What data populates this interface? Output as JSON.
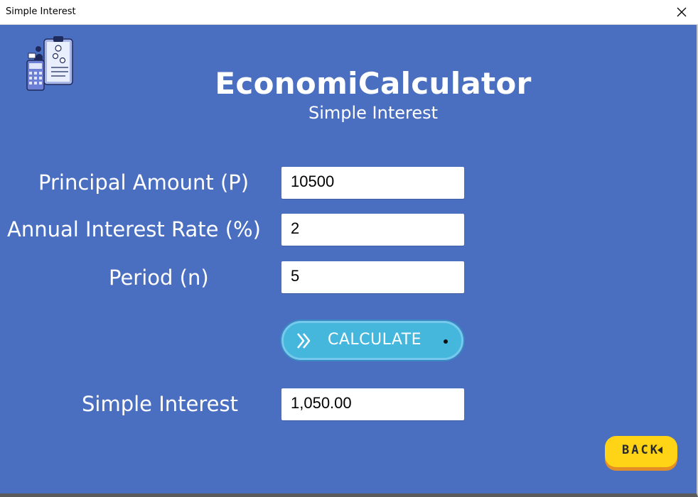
{
  "window": {
    "title": "Simple Interest"
  },
  "header": {
    "app_title": "EconomiCalculator",
    "subtitle": "Simple Interest"
  },
  "form": {
    "principal_label": "Principal Amount (P)",
    "principal_value": "10500",
    "rate_label": "Annual Interest Rate (%)",
    "rate_value": "2",
    "period_label": "Period (n)",
    "period_value": "5"
  },
  "calculate_button": {
    "label": "CALCULATE"
  },
  "result": {
    "label": "Simple Interest",
    "value": "1,050.00"
  },
  "back_button": {
    "label": "BACK"
  },
  "colors": {
    "background": "#4b6fc0",
    "calculate_button": "#45b6dc",
    "back_button": "#ffd416",
    "back_button_shadow": "#e48f25"
  },
  "icons": {
    "logo": "finance-calculator-illustration-icon",
    "close": "close-icon",
    "calculate": "double-chevron-right-icon",
    "back": "triangle-left-icon"
  }
}
